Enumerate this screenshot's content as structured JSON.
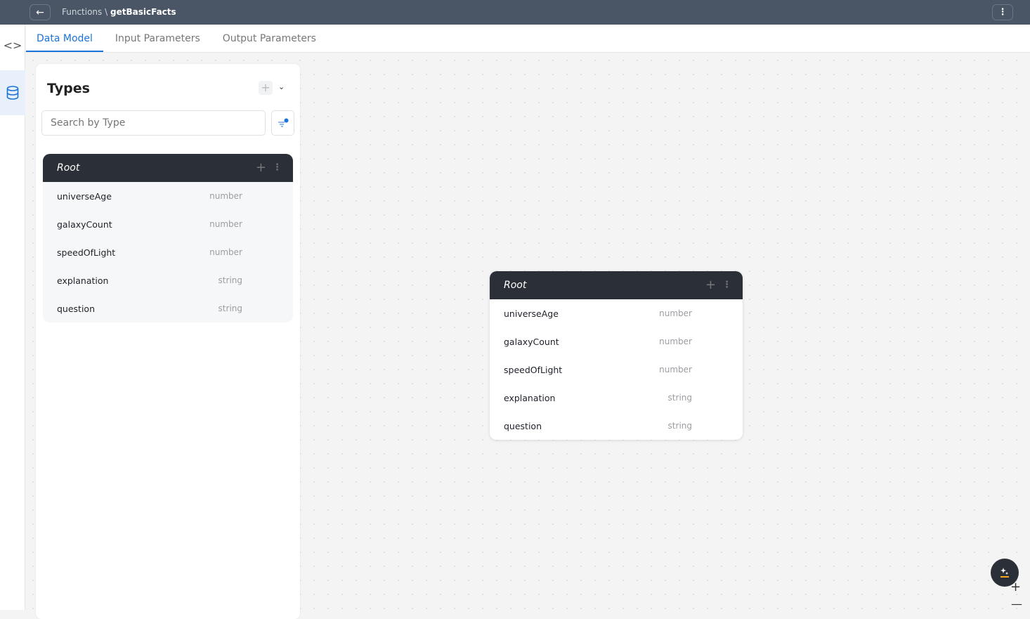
{
  "header": {
    "breadcrumb_parent": "Functions",
    "separator": "\\",
    "breadcrumb_current": "getBasicFacts"
  },
  "tabs": [
    {
      "label": "Data Model",
      "active": true
    },
    {
      "label": "Input Parameters"
    },
    {
      "label": "Output Parameters"
    }
  ],
  "panel": {
    "title": "Types",
    "search_placeholder": "Search by Type"
  },
  "root": {
    "title": "Root",
    "fields": [
      {
        "name": "universeAge",
        "type": "number"
      },
      {
        "name": "galaxyCount",
        "type": "number"
      },
      {
        "name": "speedOfLight",
        "type": "number"
      },
      {
        "name": "explanation",
        "type": "string"
      },
      {
        "name": "question",
        "type": "string"
      }
    ]
  },
  "colors": {
    "accent": "#1a73d9",
    "topbar": "#4a5565",
    "card_header": "#2b3038",
    "ai_accent": "#f5a623"
  }
}
